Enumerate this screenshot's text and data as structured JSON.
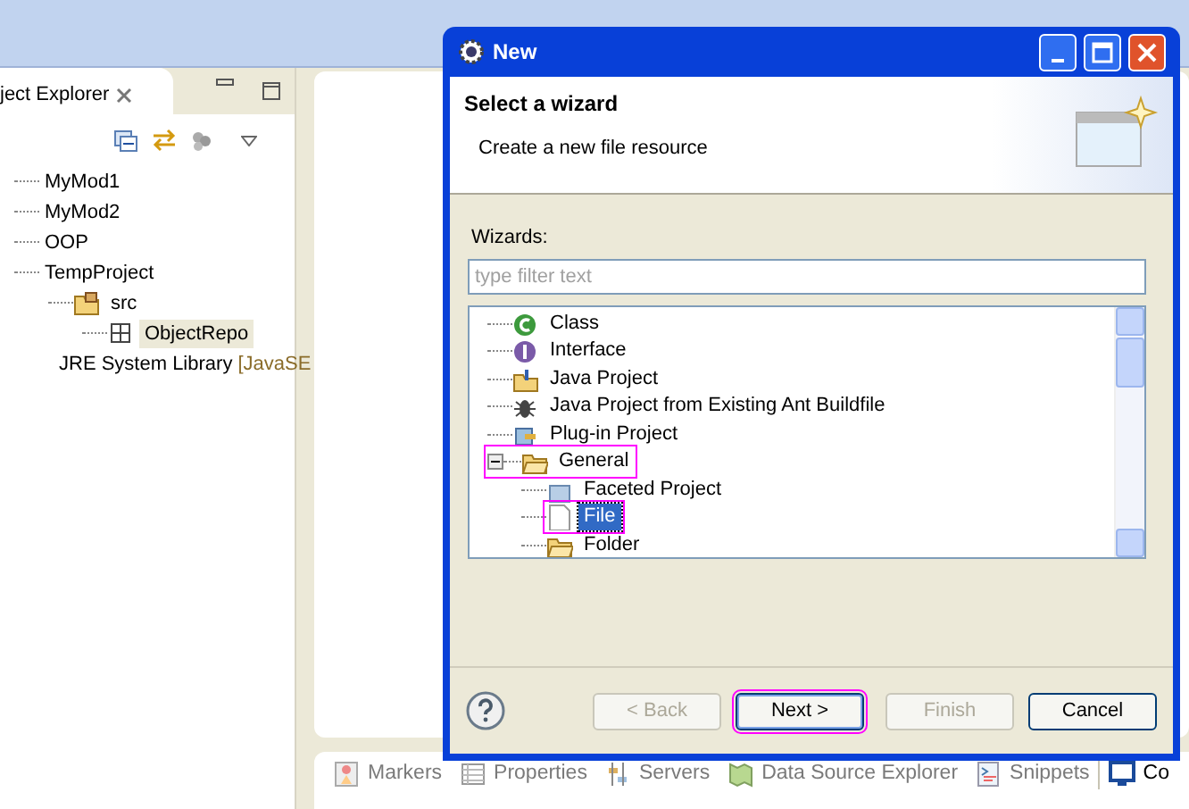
{
  "explorer": {
    "tab_title": "ject Explorer",
    "tree": [
      {
        "label": "MyMod1",
        "selected": false
      },
      {
        "label": "MyMod2",
        "selected": false
      },
      {
        "label": "OOP",
        "selected": false
      },
      {
        "label": "TempProject",
        "selected": false,
        "children": [
          {
            "label": "src",
            "kind": "package",
            "selected": false,
            "children": [
              {
                "label": "ObjectRepo",
                "kind": "grid",
                "selected": true
              }
            ]
          },
          {
            "label": "JRE System Library",
            "kind": "library",
            "decoration": "[JavaSE",
            "selected": false
          }
        ]
      }
    ]
  },
  "dialog": {
    "title": "New",
    "heading": "Select a wizard",
    "description": "Create a new file resource",
    "wizards_label": "Wizards:",
    "filter": {
      "placeholder": "type filter text"
    },
    "tree": [
      {
        "label": "Class",
        "kind": "class",
        "selected": false
      },
      {
        "label": "Interface",
        "kind": "interface",
        "selected": false
      },
      {
        "label": "Java Project",
        "kind": "project",
        "selected": false
      },
      {
        "label": "Java Project from Existing Ant Buildfile",
        "kind": "ant",
        "selected": false
      },
      {
        "label": "Plug-in Project",
        "kind": "plugin",
        "selected": false
      },
      {
        "label": "General",
        "kind": "folder",
        "selected": false,
        "expanded": true,
        "highlighted": true,
        "children": [
          {
            "label": "Faceted Project",
            "kind": "faceted",
            "selected": false
          },
          {
            "label": "File",
            "kind": "file",
            "selected": true,
            "highlighted": true
          },
          {
            "label": "Folder",
            "kind": "folder",
            "selected": false
          }
        ]
      }
    ],
    "buttons": [
      {
        "label": "< Back",
        "disabled": true,
        "default": false,
        "highlighted": false
      },
      {
        "label": "Next >",
        "disabled": false,
        "default": true,
        "highlighted": true
      },
      {
        "label": "Finish",
        "disabled": true,
        "default": false,
        "highlighted": false
      },
      {
        "label": "Cancel",
        "disabled": false,
        "default": false,
        "highlighted": false
      }
    ]
  },
  "bottom_tabs": [
    {
      "label": "Markers",
      "kind": "markers",
      "selected": false
    },
    {
      "label": "Properties",
      "kind": "properties",
      "selected": false
    },
    {
      "label": "Servers",
      "kind": "servers",
      "selected": false
    },
    {
      "label": "Data Source Explorer",
      "kind": "datasource",
      "selected": false
    },
    {
      "label": "Snippets",
      "kind": "snippets",
      "selected": false
    },
    {
      "label": "Co",
      "kind": "console",
      "selected": true
    }
  ]
}
